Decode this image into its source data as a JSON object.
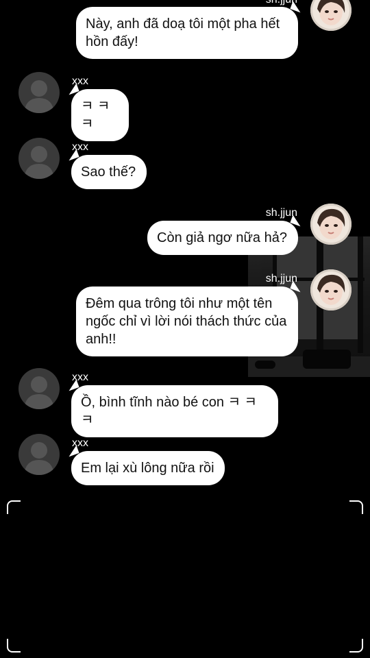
{
  "messages": [
    {
      "sender": "sh.jjun",
      "text": "Này, anh đã doạ tôi một pha hết hồn đấy!"
    },
    {
      "sender": "xxx",
      "text": "ㅋ ㅋ ㅋ"
    },
    {
      "sender": "xxx",
      "text": "Sao thế?"
    },
    {
      "sender": "sh.jjun",
      "text": "Còn giả ngơ nữa hả?"
    },
    {
      "sender": "sh.jjun",
      "text": "Đêm qua trông tôi như một tên ngốc chỉ vì lời nói thách thức của anh!!"
    },
    {
      "sender": "xxx",
      "text": "Ồ, bình tĩnh nào bé con ㅋ ㅋ ㅋ"
    },
    {
      "sender": "xxx",
      "text": "Em lại xù lông nữa rồi"
    }
  ],
  "colors": {
    "background": "#000000",
    "bubble": "#ffffff",
    "placeholder_avatar": "#3a3a3a"
  }
}
